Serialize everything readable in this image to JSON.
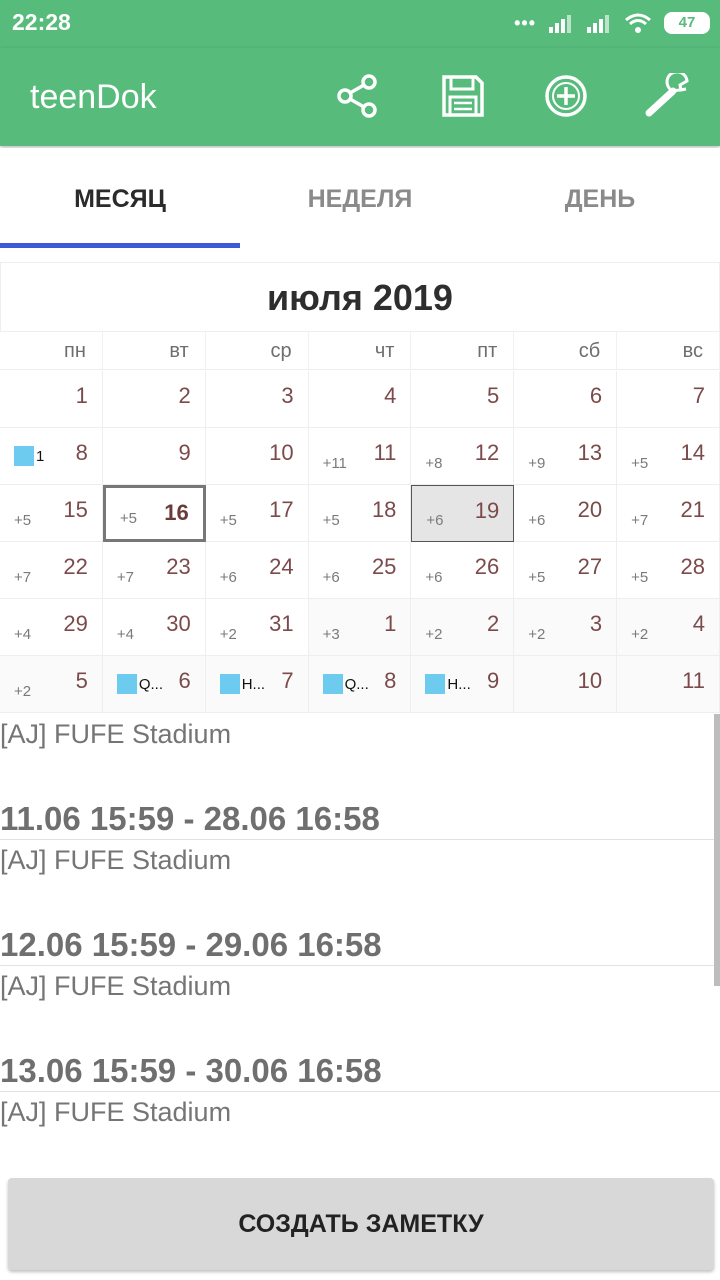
{
  "status_bar": {
    "time": "22:28",
    "battery": "47"
  },
  "app": {
    "title": "teenDok"
  },
  "toolbar": {
    "icons": [
      "share-icon",
      "save-icon",
      "add-icon",
      "settings-icon"
    ]
  },
  "tabs": [
    {
      "label": "МЕСЯЦ",
      "active": true
    },
    {
      "label": "НЕДЕЛЯ",
      "active": false
    },
    {
      "label": "ДЕНЬ",
      "active": false
    }
  ],
  "calendar": {
    "month_title": "июля 2019",
    "weekdays": [
      "пн",
      "вт",
      "ср",
      "чт",
      "пт",
      "сб",
      "вс"
    ],
    "event_color": "#6ecbf0",
    "cells": [
      {
        "day": "1"
      },
      {
        "day": "2"
      },
      {
        "day": "3"
      },
      {
        "day": "4"
      },
      {
        "day": "5"
      },
      {
        "day": "6"
      },
      {
        "day": "7"
      },
      {
        "day": "8",
        "event": "1"
      },
      {
        "day": "9"
      },
      {
        "day": "10"
      },
      {
        "day": "11",
        "more": "+11"
      },
      {
        "day": "12",
        "more": "+8"
      },
      {
        "day": "13",
        "more": "+9"
      },
      {
        "day": "14",
        "more": "+5"
      },
      {
        "day": "15",
        "more": "+5"
      },
      {
        "day": "16",
        "more": "+5",
        "today": true
      },
      {
        "day": "17",
        "more": "+5"
      },
      {
        "day": "18",
        "more": "+5"
      },
      {
        "day": "19",
        "more": "+6",
        "selected": true
      },
      {
        "day": "20",
        "more": "+6"
      },
      {
        "day": "21",
        "more": "+7"
      },
      {
        "day": "22",
        "more": "+7"
      },
      {
        "day": "23",
        "more": "+7"
      },
      {
        "day": "24",
        "more": "+6"
      },
      {
        "day": "25",
        "more": "+6"
      },
      {
        "day": "26",
        "more": "+6"
      },
      {
        "day": "27",
        "more": "+5"
      },
      {
        "day": "28",
        "more": "+5"
      },
      {
        "day": "29",
        "more": "+4"
      },
      {
        "day": "30",
        "more": "+4"
      },
      {
        "day": "31",
        "more": "+2"
      },
      {
        "day": "1",
        "more": "+3",
        "other": true
      },
      {
        "day": "2",
        "more": "+2",
        "other": true
      },
      {
        "day": "3",
        "more": "+2",
        "other": true
      },
      {
        "day": "4",
        "more": "+2",
        "other": true
      },
      {
        "day": "5",
        "more": "+2",
        "other": true
      },
      {
        "day": "6",
        "event": "Q...",
        "other": true
      },
      {
        "day": "7",
        "event": "H...",
        "other": true
      },
      {
        "day": "8",
        "event": "Q...",
        "other": true
      },
      {
        "day": "9",
        "event": "H...",
        "other": true
      },
      {
        "day": "10",
        "other": true
      },
      {
        "day": "11",
        "other": true
      }
    ]
  },
  "events": [
    {
      "location": "[AJ] FUFE Stadium",
      "time": "11.06 15:59 - 28.06 16:58"
    },
    {
      "location": "[AJ] FUFE Stadium",
      "time": "12.06 15:59 - 29.06 16:58"
    },
    {
      "location": "[AJ] FUFE Stadium",
      "time": "13.06 15:59 - 30.06 16:58"
    },
    {
      "location": "[AJ] FUFE Stadium",
      "time": ""
    }
  ],
  "create_button": {
    "label": "СОЗДАТЬ ЗАМЕТКУ"
  }
}
